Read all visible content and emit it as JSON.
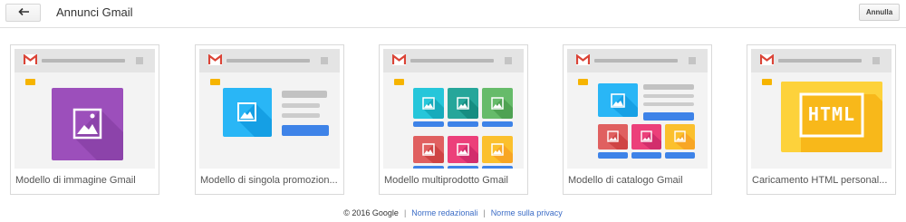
{
  "header": {
    "back_icon": "arrow-left-icon",
    "title": "Annunci Gmail",
    "cancel_label": "Annulla"
  },
  "templates": [
    {
      "label": "Modello di immagine Gmail"
    },
    {
      "label": "Modello di singola promozion..."
    },
    {
      "label": "Modello multiprodotto Gmail"
    },
    {
      "label": "Modello di catalogo Gmail"
    },
    {
      "label": "Caricamento HTML personal..."
    }
  ],
  "html_badge": "HTML",
  "footer": {
    "copyright": "© 2016 Google",
    "editorial_policy": "Norme redazionali",
    "privacy_policy": "Norme sulla privacy"
  },
  "colors": {
    "gmail_red": "#db4437",
    "purple": "#9c4fbb",
    "light_blue": "#29b6f6",
    "blue_button": "#3e83e8",
    "teal": "#26a69a",
    "green": "#66bb6a",
    "red": "#e06060",
    "pink": "#ec407a",
    "yellow": "#f6b400"
  }
}
